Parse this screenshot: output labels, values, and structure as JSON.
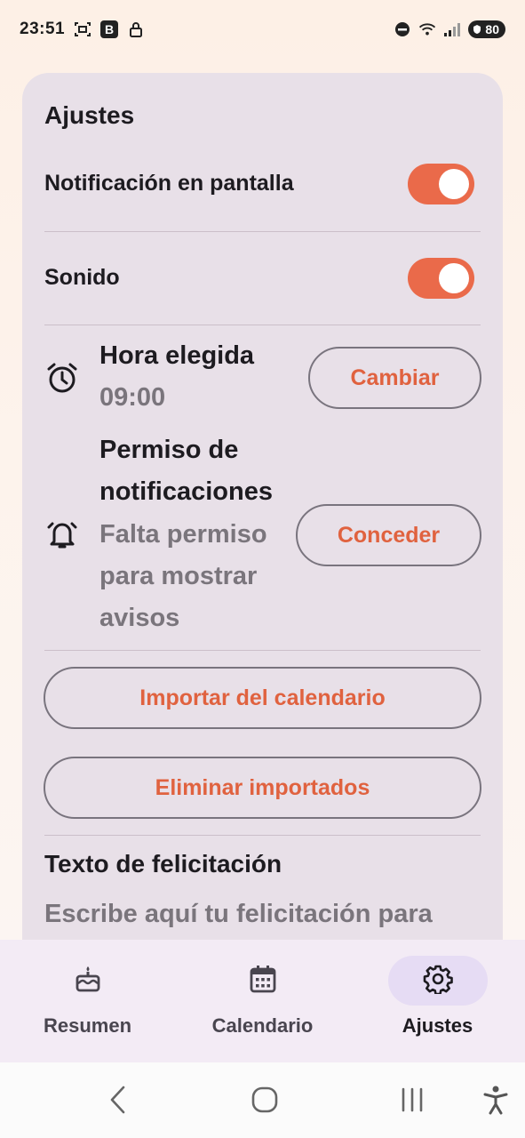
{
  "status_bar": {
    "time": "23:51",
    "b_badge": "B",
    "battery": "80",
    "icons": [
      "screenshot-icon",
      "b-app-icon",
      "lock-icon",
      "dnd-icon",
      "wifi-icon",
      "signal-icon",
      "battery-icon"
    ]
  },
  "settings": {
    "title": "Ajustes",
    "on_screen_notification": {
      "label": "Notificación en pantalla",
      "enabled": true
    },
    "sound": {
      "label": "Sonido",
      "enabled": true
    },
    "chosen_time": {
      "label": "Hora elegida",
      "value": "09:00",
      "button": "Cambiar",
      "icon": "alarm-clock-icon"
    },
    "notification_permission": {
      "label_line1": "Permiso de",
      "label_line2": "notificaciones",
      "status_line1": "Falta permiso",
      "status_line2": "para mostrar",
      "status_line3": "avisos",
      "button": "Conceder",
      "icon": "alarm-bell-icon"
    },
    "import_button": "Importar del calendario",
    "delete_button": "Eliminar importados",
    "greeting_section_title": "Texto de felicitación",
    "greeting_placeholder": "Escribe aquí tu felicitación para"
  },
  "bottom_nav": {
    "items": [
      {
        "label": "Resumen",
        "icon": "cake-icon",
        "active": false
      },
      {
        "label": "Calendario",
        "icon": "calendar-icon",
        "active": false
      },
      {
        "label": "Ajustes",
        "icon": "gear-icon",
        "active": true
      }
    ]
  },
  "colors": {
    "accent": "#ea6a4a",
    "button_text": "#e0623f",
    "card_bg": "#e8e0e8",
    "nav_bg": "#f3ebf5",
    "active_pill": "#e6dcf4"
  }
}
